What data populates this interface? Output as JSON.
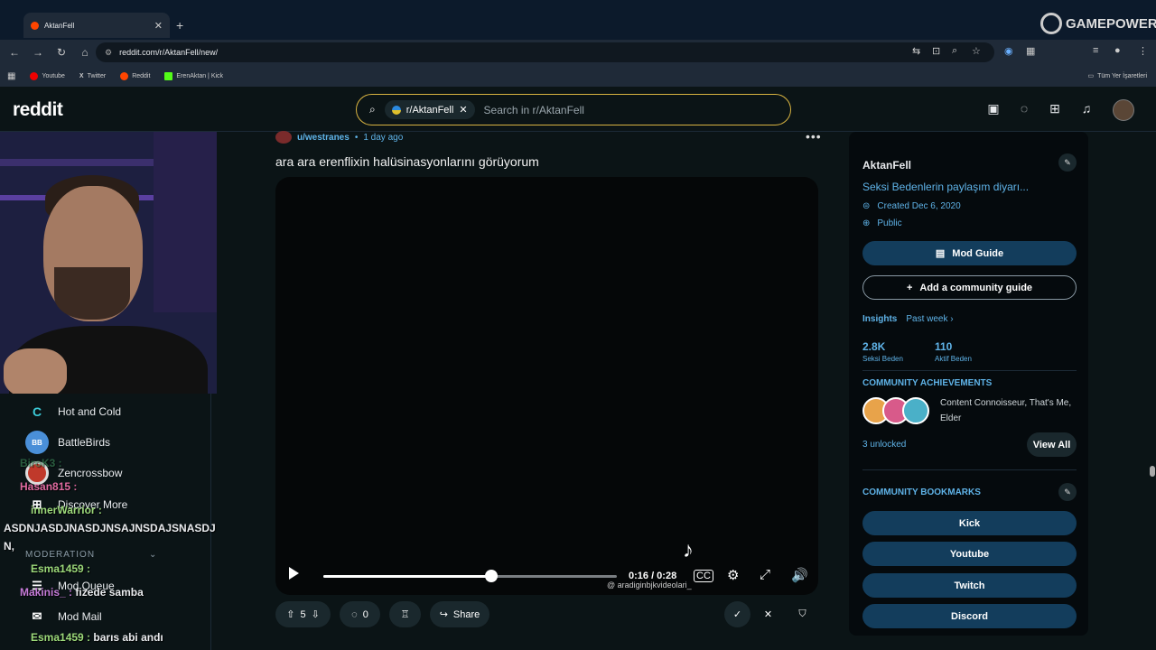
{
  "browser": {
    "tab_title": "AktanFell",
    "url": "reddit.com/r/AktanFell/new/",
    "bookmarks": [
      "Youtube",
      "Twitter",
      "Reddit",
      "ErenAktan | Kick"
    ],
    "bookmarks_right": "Tüm Yer İşaretleri",
    "watermark": "GAMEPOWER"
  },
  "header": {
    "logo": "reddit",
    "search_chip": "r/AktanFell",
    "search_placeholder": "Search in r/AktanFell"
  },
  "left_nav": {
    "games": [
      "Hot and Cold",
      "BattleBirds",
      "Zencrossbow"
    ],
    "discover": "Discover More",
    "moderation_label": "MODERATION",
    "mod_items": [
      "Mod Queue",
      "Mod Mail"
    ]
  },
  "chat_overlay": [
    {
      "nick": "BiroK3 :",
      "msg": ""
    },
    {
      "nick": "Hasan815 :",
      "msg": ""
    },
    {
      "nick": "innerWarrior :",
      "msg": ""
    },
    {
      "nick": "",
      "msg": "ASDNJASDJNASDJNSAJNSDAJSNASDJ"
    },
    {
      "nick": "",
      "msg": "N,"
    },
    {
      "nick": "Esma1459 :",
      "msg": ""
    },
    {
      "nick": "Makinis_ :",
      "msg": "fizede samba"
    },
    {
      "nick": "Esma1459 :",
      "msg": "barıs abi andı"
    }
  ],
  "post": {
    "author": "u/westranes",
    "age": "1 day ago",
    "title": "ara ara erenflixin halüsinasyonlarını görüyorum",
    "video_time": "0:16 / 0:28",
    "video_progress": 0.571,
    "tiktok_user": "@ aradiginbjkvideolari_",
    "tiktok_label": "TikTok",
    "upvotes": "5",
    "comments": "0",
    "share_label": "Share"
  },
  "sidebar": {
    "name": "AktanFell",
    "description": "Seksi Bedenlerin paylaşım diyarı...",
    "created": "Created Dec 6, 2020",
    "visibility": "Public",
    "mod_guide": "Mod Guide",
    "add_guide": "Add a community guide",
    "insights": "Insights",
    "period": "Past week",
    "stat1_value": "2.8K",
    "stat1_label": "Seksi Beden",
    "stat2_value": "110",
    "stat2_label": "Aktif Beden",
    "achievements_head": "COMMUNITY ACHIEVEMENTS",
    "achievements_text": "Content Connoisseur, That's Me, Elder",
    "unlocked": "3 unlocked",
    "view_all": "View All",
    "bookmarks_head": "COMMUNITY BOOKMARKS",
    "bookmarks": [
      "Kick",
      "Youtube",
      "Twitch",
      "Discord"
    ]
  },
  "colors": {
    "accent": "#5fb3e8",
    "search_border": "#d8b341",
    "button_fill": "#133d5c"
  }
}
